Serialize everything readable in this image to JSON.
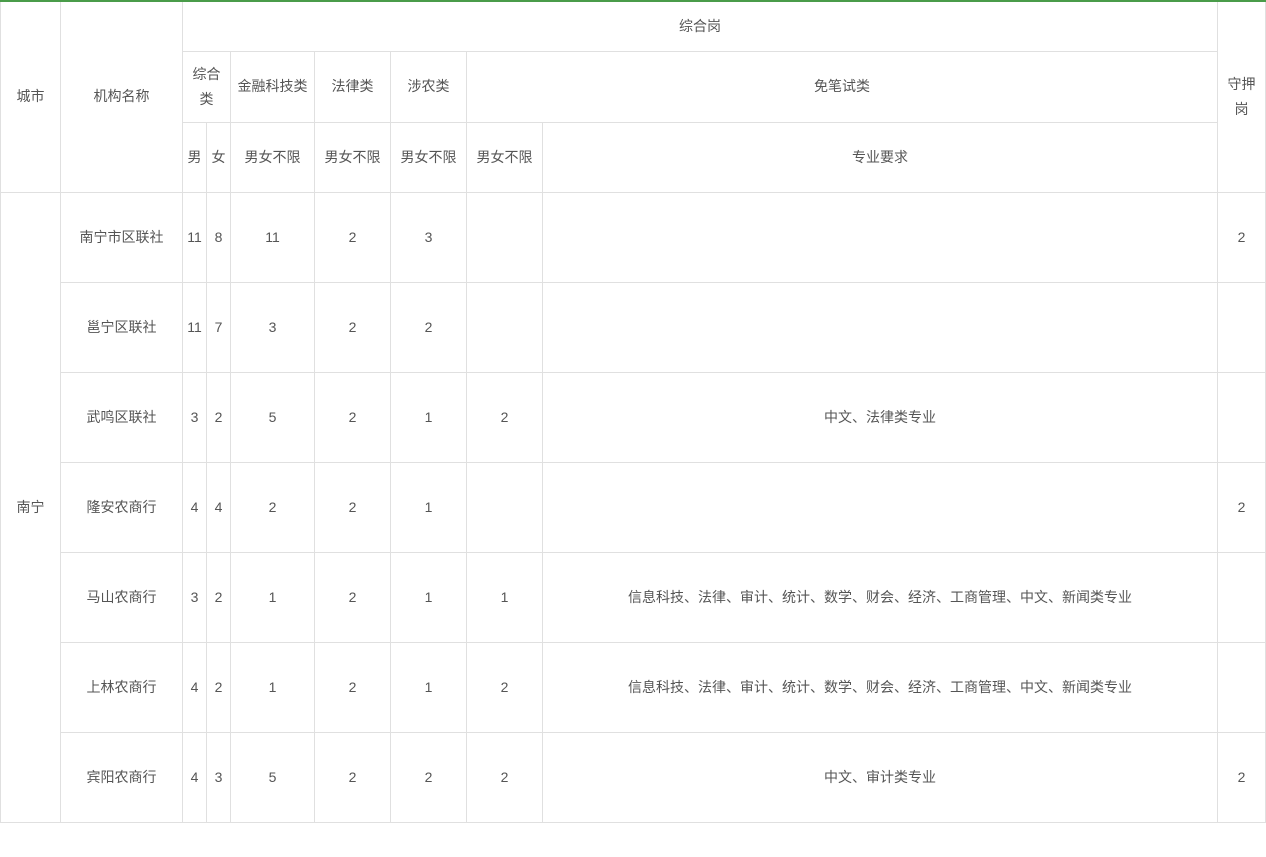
{
  "headers": {
    "city": "城市",
    "org": "机构名称",
    "comprehensive_post": "综合岗",
    "guard_post": "守押岗",
    "comprehensive_cat": "综合类",
    "fintech_cat": "金融科技类",
    "law_cat": "法律类",
    "agri_cat": "涉农类",
    "exempt_cat": "免笔试类",
    "male": "男",
    "female": "女",
    "unlimited": "男女不限",
    "major_req": "专业要求"
  },
  "city": "南宁",
  "rows": [
    {
      "org": "南宁市区联社",
      "male": "11",
      "female": "8",
      "fintech": "11",
      "law": "2",
      "agri": "3",
      "exempt": "",
      "req": "",
      "guard": "2"
    },
    {
      "org": "邕宁区联社",
      "male": "11",
      "female": "7",
      "fintech": "3",
      "law": "2",
      "agri": "2",
      "exempt": "",
      "req": "",
      "guard": ""
    },
    {
      "org": "武鸣区联社",
      "male": "3",
      "female": "2",
      "fintech": "5",
      "law": "2",
      "agri": "1",
      "exempt": "2",
      "req": "中文、法律类专业",
      "guard": ""
    },
    {
      "org": "隆安农商行",
      "male": "4",
      "female": "4",
      "fintech": "2",
      "law": "2",
      "agri": "1",
      "exempt": "",
      "req": "",
      "guard": "2"
    },
    {
      "org": "马山农商行",
      "male": "3",
      "female": "2",
      "fintech": "1",
      "law": "2",
      "agri": "1",
      "exempt": "1",
      "req": "信息科技、法律、审计、统计、数学、财会、经济、工商管理、中文、新闻类专业",
      "guard": ""
    },
    {
      "org": "上林农商行",
      "male": "4",
      "female": "2",
      "fintech": "1",
      "law": "2",
      "agri": "1",
      "exempt": "2",
      "req": "信息科技、法律、审计、统计、数学、财会、经济、工商管理、中文、新闻类专业",
      "guard": ""
    },
    {
      "org": "宾阳农商行",
      "male": "4",
      "female": "3",
      "fintech": "5",
      "law": "2",
      "agri": "2",
      "exempt": "2",
      "req": "中文、审计类专业",
      "guard": "2"
    }
  ]
}
